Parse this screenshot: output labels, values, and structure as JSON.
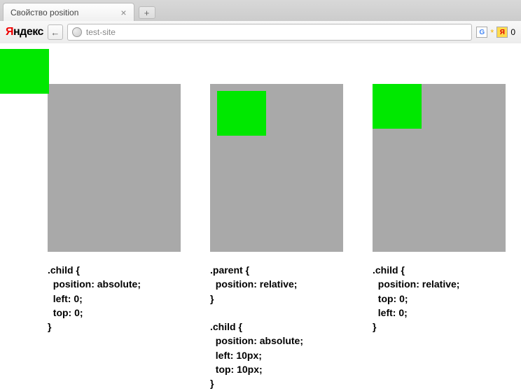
{
  "browser": {
    "tab_title": "Свойство position",
    "tab_close": "×",
    "new_tab": "+",
    "back_arrow": "←",
    "url": "test-site",
    "logo_y": "Я",
    "logo_rest": "ндекс",
    "g_label": "G",
    "star": "*",
    "ya_label": "Я",
    "count": "0"
  },
  "examples": [
    {
      "code": ".child {\n  position: absolute;\n  left: 0;\n  top: 0;\n}"
    },
    {
      "code": ".parent {\n  position: relative;\n}\n\n.child {\n  position: absolute;\n  left: 10px;\n  top: 10px;\n}"
    },
    {
      "code": ".child {\n  position: relative;\n  top: 0;\n  left: 0;\n}"
    }
  ]
}
